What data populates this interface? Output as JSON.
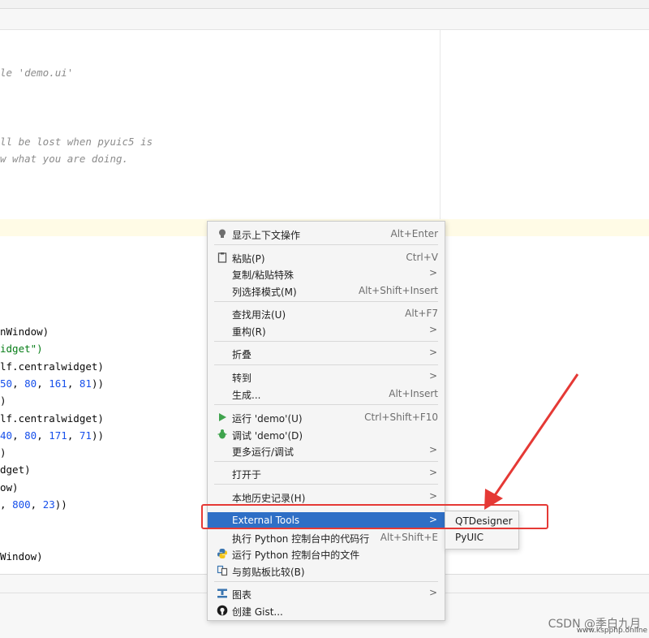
{
  "code": {
    "comment_lines": [
      "le 'demo.ui'",
      "ll be lost when pyuic5 is",
      "w what you are doing."
    ],
    "lines": [
      {
        "segments": [
          {
            "t": "nWindow)",
            "c": ""
          }
        ]
      },
      {
        "segments": [
          {
            "t": "idget\")",
            "c": "str"
          }
        ]
      },
      {
        "segments": [
          {
            "t": "lf.centralwidget)",
            "c": ""
          }
        ]
      },
      {
        "segments": [
          {
            "t": "50",
            "c": "num"
          },
          {
            "t": ", ",
            "c": ""
          },
          {
            "t": "80",
            "c": "num"
          },
          {
            "t": ", ",
            "c": ""
          },
          {
            "t": "161",
            "c": "num"
          },
          {
            "t": ", ",
            "c": ""
          },
          {
            "t": "81",
            "c": "num"
          },
          {
            "t": "))",
            "c": ""
          }
        ]
      },
      {
        "segments": [
          {
            "t": ")",
            "c": ""
          }
        ]
      },
      {
        "segments": [
          {
            "t": "lf.centralwidget)",
            "c": ""
          }
        ]
      },
      {
        "segments": [
          {
            "t": "40",
            "c": "num"
          },
          {
            "t": ", ",
            "c": ""
          },
          {
            "t": "80",
            "c": "num"
          },
          {
            "t": ", ",
            "c": ""
          },
          {
            "t": "171",
            "c": "num"
          },
          {
            "t": ", ",
            "c": ""
          },
          {
            "t": "71",
            "c": "num"
          },
          {
            "t": "))",
            "c": ""
          }
        ]
      },
      {
        "segments": [
          {
            "t": ")",
            "c": ""
          }
        ]
      },
      {
        "segments": [
          {
            "t": "dget)",
            "c": ""
          }
        ]
      },
      {
        "segments": [
          {
            "t": "ow)",
            "c": ""
          }
        ]
      },
      {
        "segments": [
          {
            "t": ", ",
            "c": ""
          },
          {
            "t": "800",
            "c": "num"
          },
          {
            "t": ", ",
            "c": ""
          },
          {
            "t": "23",
            "c": "num"
          },
          {
            "t": "))",
            "c": ""
          }
        ]
      },
      {
        "segments": [
          {
            "t": "",
            "c": ""
          }
        ]
      },
      {
        "segments": [
          {
            "t": "",
            "c": ""
          }
        ]
      },
      {
        "segments": [
          {
            "t": "Window)",
            "c": ""
          }
        ]
      }
    ]
  },
  "menu": {
    "items": [
      {
        "label": "显示上下文操作",
        "shortcut": "Alt+Enter",
        "icon": "lightbulb-icon"
      },
      {
        "label": "粘贴(P)",
        "shortcut": "Ctrl+V",
        "icon": "clipboard-icon"
      },
      {
        "label": "复制/粘贴特殊",
        "submenu": ">"
      },
      {
        "label": "列选择模式(M)",
        "shortcut": "Alt+Shift+Insert"
      },
      {
        "label": "查找用法(U)",
        "shortcut": "Alt+F7"
      },
      {
        "label": "重构(R)",
        "submenu": ">"
      },
      {
        "label": "折叠",
        "submenu": ">"
      },
      {
        "label": "转到",
        "submenu": ">"
      },
      {
        "label": "生成...",
        "shortcut": "Alt+Insert"
      },
      {
        "label": "运行 'demo'(U)",
        "shortcut": "Ctrl+Shift+F10",
        "icon": "run-icon"
      },
      {
        "label": "调试 'demo'(D)",
        "icon": "debug-icon"
      },
      {
        "label": "更多运行/调试",
        "submenu": ">"
      },
      {
        "label": "打开于",
        "submenu": ">"
      },
      {
        "label": "本地历史记录(H)",
        "submenu": ">"
      },
      {
        "label": "External Tools",
        "submenu": ">"
      },
      {
        "label": "执行 Python 控制台中的代码行",
        "shortcut": "Alt+Shift+E"
      },
      {
        "label": "运行 Python 控制台中的文件",
        "icon": "python-icon"
      },
      {
        "label": "与剪贴板比较(B)",
        "icon": "compare-icon"
      },
      {
        "label": "图表",
        "submenu": ">",
        "icon": "diagram-icon"
      },
      {
        "label": "创建 Gist...",
        "icon": "github-icon"
      }
    ]
  },
  "submenu": {
    "items": [
      "QTDesigner",
      "PyUIC"
    ]
  },
  "watermark": {
    "text": "CSDN @季白九月",
    "site": "www.kspphp.online"
  },
  "colors": {
    "highlight": "#2f6fc6",
    "annotation": "#e53935"
  }
}
